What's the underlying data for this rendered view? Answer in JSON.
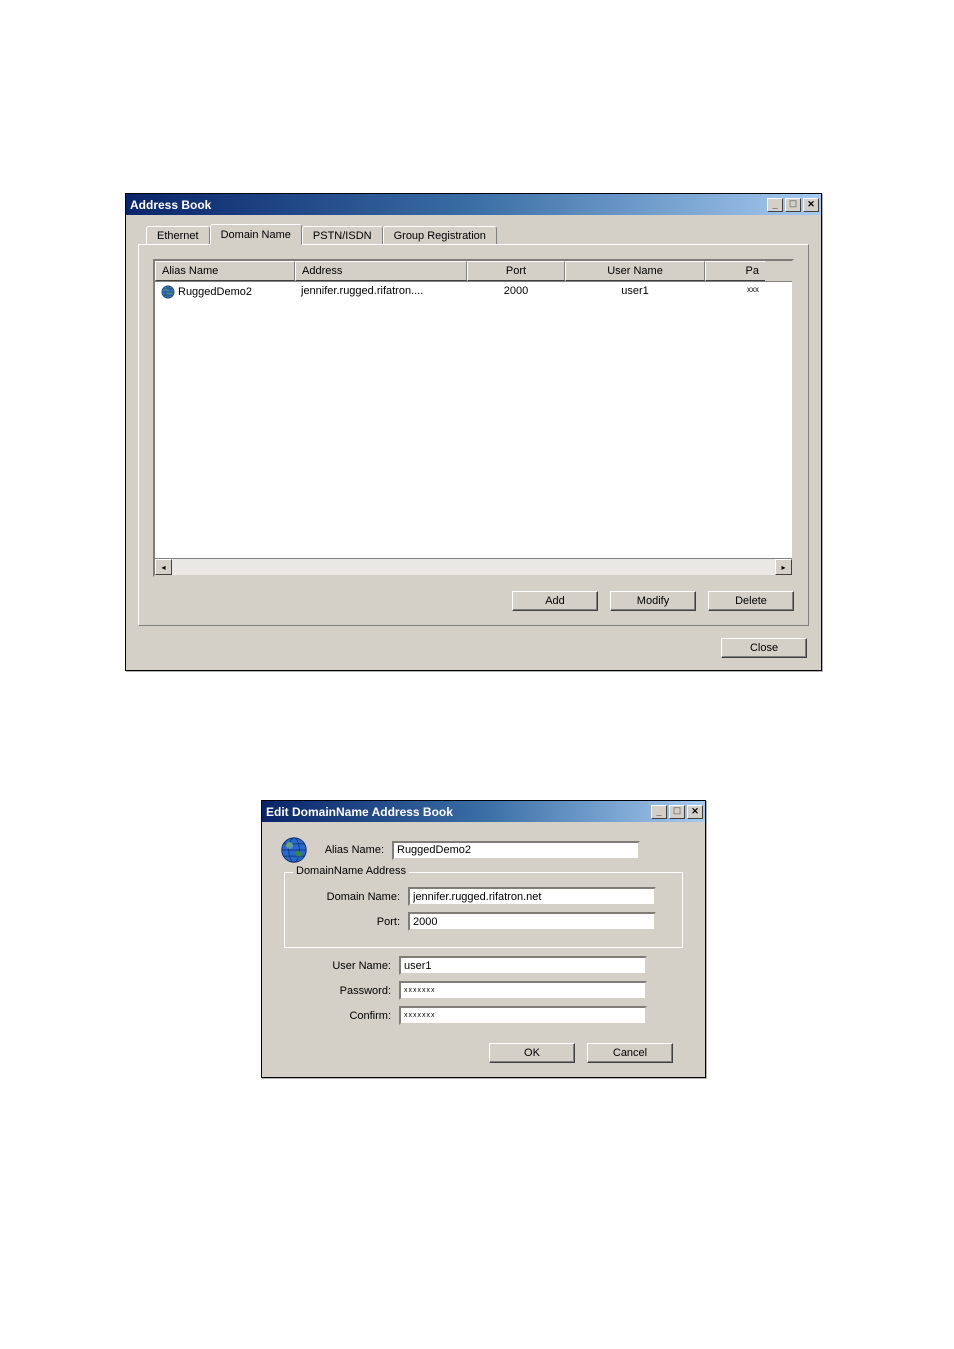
{
  "address_book": {
    "title": "Address Book",
    "tabs": {
      "ethernet": "Ethernet",
      "domain_name": "Domain Name",
      "pstn_isdn": "PSTN/ISDN",
      "group_registration": "Group Registration"
    },
    "columns": {
      "alias_name": "Alias Name",
      "address": "Address",
      "port": "Port",
      "user_name": "User Name",
      "password": "Pa"
    },
    "rows": [
      {
        "alias": "RuggedDemo2",
        "address": "jennifer.rugged.rifatron....",
        "port": "2000",
        "user": "user1",
        "pass": "xxx"
      }
    ],
    "buttons": {
      "add": "Add",
      "modify": "Modify",
      "delete": "Delete",
      "close": "Close"
    }
  },
  "edit_dialog": {
    "title": "Edit DomainName Address Book",
    "labels": {
      "alias_name": "Alias Name:",
      "group": "DomainName Address",
      "domain_name": "Domain Name:",
      "port": "Port:",
      "user_name": "User Name:",
      "password": "Password:",
      "confirm": "Confirm:"
    },
    "values": {
      "alias_name": "RuggedDemo2",
      "domain_name": "jennifer.rugged.rifatron.net",
      "port": "2000",
      "user_name": "user1",
      "password": "xxxxxxx",
      "confirm": "xxxxxxx"
    },
    "buttons": {
      "ok": "OK",
      "cancel": "Cancel"
    }
  }
}
